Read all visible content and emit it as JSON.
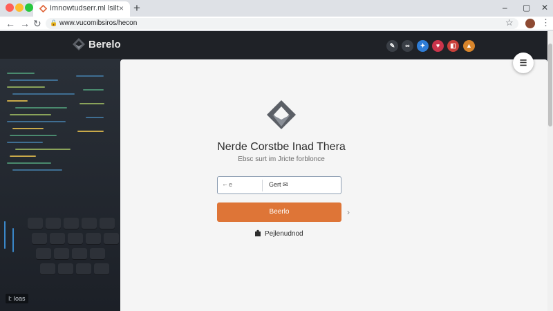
{
  "browser": {
    "tab": {
      "title": "Imnowtudserr.ml lsilt",
      "close_icon": "×"
    },
    "new_tab_icon": "+",
    "window_controls": {
      "minimize": "–",
      "maximize": "▢",
      "close": "✕"
    },
    "nav": {
      "back": "←",
      "forward": "→",
      "reload": "↻"
    },
    "url": "www.vucomibsiros/hecon",
    "star_icon": "☆",
    "menu_icon": "⋮",
    "traffic_colors": [
      "#ff5f57",
      "#febc2e",
      "#28c840"
    ]
  },
  "site": {
    "brand_name": "Berelo",
    "social": [
      {
        "icon": "edit-icon",
        "glyph": "✎",
        "color": "#3a3f46"
      },
      {
        "icon": "link-icon",
        "glyph": "∞",
        "color": "#3a3f46"
      },
      {
        "icon": "twitter-icon",
        "glyph": "✦",
        "color": "#2f7dd6"
      },
      {
        "icon": "heart-icon",
        "glyph": "♥",
        "color": "#c9344b"
      },
      {
        "icon": "rss-icon",
        "glyph": "◧",
        "color": "#c8403a"
      },
      {
        "icon": "warning-icon",
        "glyph": "▲",
        "color": "#d8852b"
      }
    ],
    "float_button_glyph": "☰",
    "hero_caption": "I: Ioas",
    "card": {
      "heading": "Nerde Corstbe Inad Thera",
      "subheading": "Ebsc surt im Jricte forblonce",
      "login_field": {
        "icon": "←",
        "left_text": "e",
        "right_text": "Gert ✉"
      },
      "primary_button": "Beerlo",
      "chevron": "›",
      "secondary_link": "Pejlenudnod"
    },
    "colors": {
      "accent": "#de7537",
      "dark": "#242830",
      "logo_gray": "#5b5f66"
    }
  }
}
